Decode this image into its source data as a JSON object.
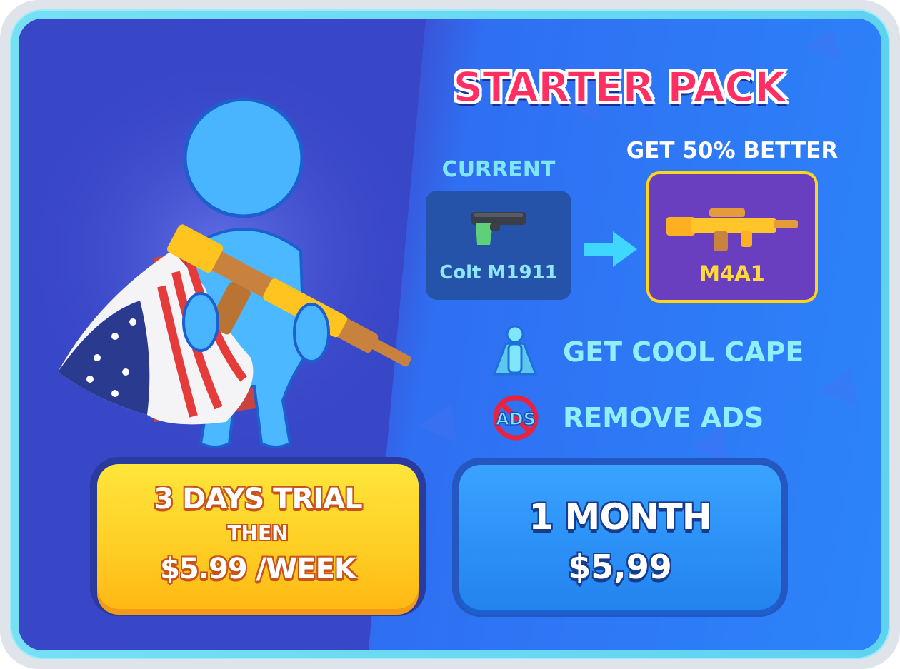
{
  "offer": {
    "title": "STARTER PACK",
    "current_label": "CURRENT",
    "upgrade_label": "GET 50% BETTER",
    "current_weapon": {
      "name": "Colt M1911",
      "icon": "pistol-icon"
    },
    "new_weapon": {
      "name": "M4A1",
      "icon": "rifle-icon"
    },
    "arrow_icon": "arrow-right-icon"
  },
  "perks": [
    {
      "label": "GET COOL CAPE",
      "icon": "cape-figure-icon"
    },
    {
      "label": "REMOVE ADS",
      "icon": "no-ads-icon",
      "icon_text": "ADS"
    }
  ],
  "buttons": {
    "trial": {
      "line1": "3 DAYS TRIAL",
      "line2": "THEN",
      "line3": "$5.99 /WEEK"
    },
    "month": {
      "line1": "1 MONTH",
      "line2": "$5,99"
    }
  },
  "colors": {
    "title": "#ff2f63",
    "trial_button": "#ffcd24",
    "month_button": "#2b8ff6",
    "perk_text": "#8ff0fb",
    "highlight_border": "#ffd51a"
  }
}
